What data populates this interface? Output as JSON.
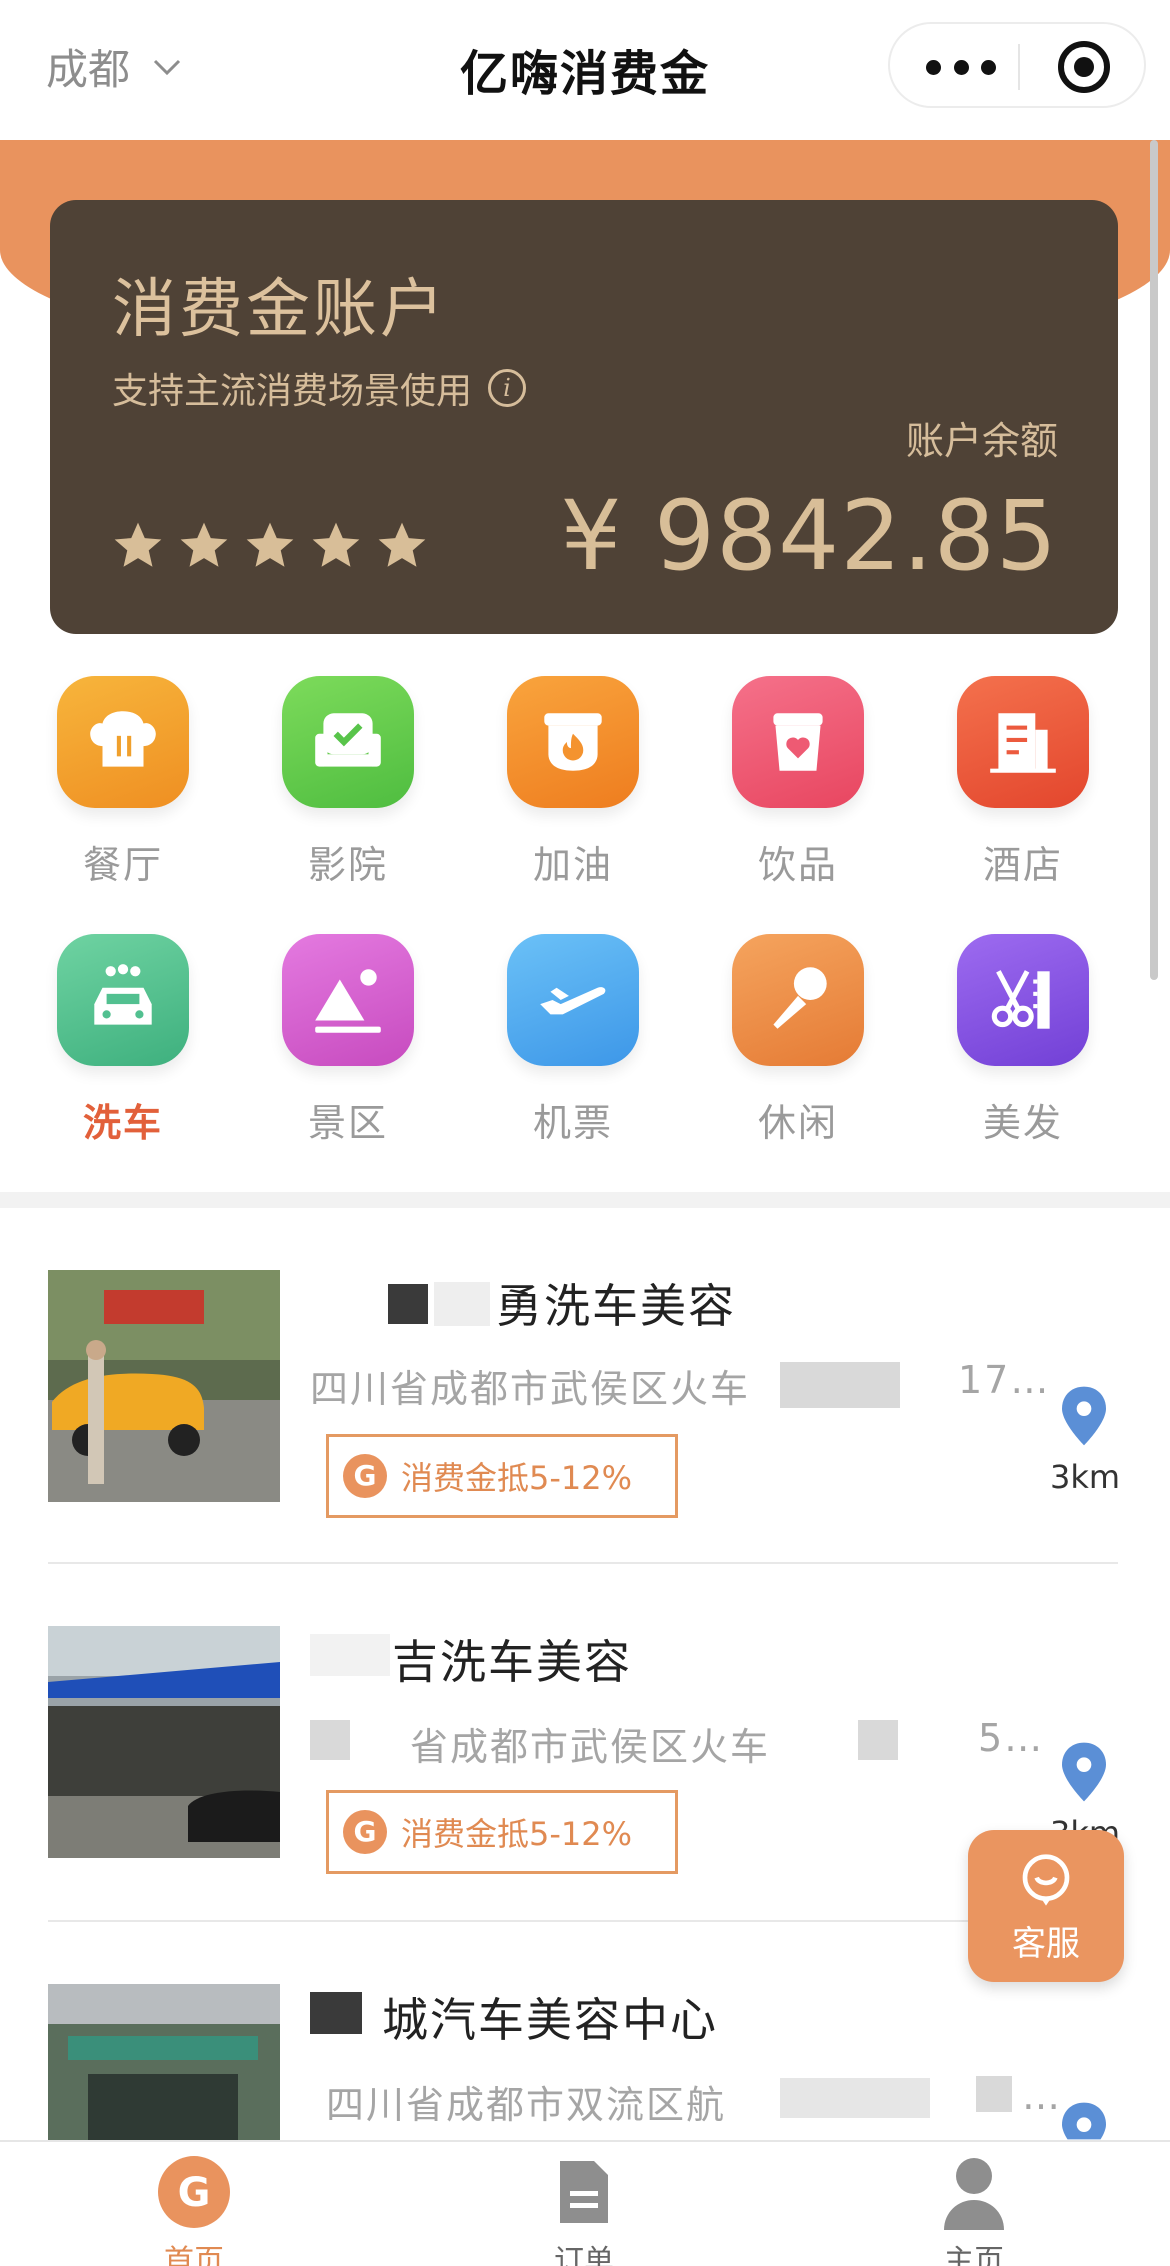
{
  "header": {
    "city": "成都",
    "title": "亿嗨消费金"
  },
  "account": {
    "title": "消费金账户",
    "subtitle": "支持主流消费场景使用",
    "info_icon_text": "i",
    "balance_label": "账户余额",
    "balance": "¥ 9842.85",
    "stars": 5
  },
  "categories": [
    {
      "label": "餐厅",
      "icon": "chef-hat-icon",
      "color": "#f0a02c"
    },
    {
      "label": "影院",
      "icon": "armchair-icon",
      "color": "#68cc4e"
    },
    {
      "label": "加油",
      "icon": "flame-icon",
      "color": "#f4932f"
    },
    {
      "label": "饮品",
      "icon": "cup-heart-icon",
      "color": "#ee5a73"
    },
    {
      "label": "酒店",
      "icon": "hotel-icon",
      "color": "#ec5a3e"
    },
    {
      "label": "洗车",
      "icon": "car-icon",
      "color": "#52c090",
      "active": true
    },
    {
      "label": "景区",
      "icon": "mountain-icon",
      "color": "#d561cf"
    },
    {
      "label": "机票",
      "icon": "airplane-icon",
      "color": "#56aef0"
    },
    {
      "label": "休闲",
      "icon": "microphone-icon",
      "color": "#f08e45"
    },
    {
      "label": "美发",
      "icon": "scissors-icon",
      "color": "#8754e3"
    }
  ],
  "shops": [
    {
      "name": "勇洗车美容",
      "address": "四川省成都市武侯区火车",
      "address_tail": "17…",
      "tag": "消费金抵5-12%",
      "coin": "G",
      "distance": "3km"
    },
    {
      "name": "吉洗车美容",
      "address": "省成都市武侯区火车",
      "address_tail": "5…",
      "tag": "消费金抵5-12%",
      "coin": "G",
      "distance": "3km"
    },
    {
      "name": "城汽车美容中心",
      "address": "四川省成都市双流区航",
      "address_tail": "…",
      "tag": "",
      "coin": "",
      "distance": ""
    }
  ],
  "service": {
    "label": "客服"
  },
  "tabs": [
    {
      "label": "首页",
      "active": true
    },
    {
      "label": "订单"
    },
    {
      "label": "主页"
    }
  ],
  "colors": {
    "accent": "#e9935e",
    "card": "#4f4236",
    "gold_text": "#d8be98",
    "active_label": "#e2603a"
  }
}
